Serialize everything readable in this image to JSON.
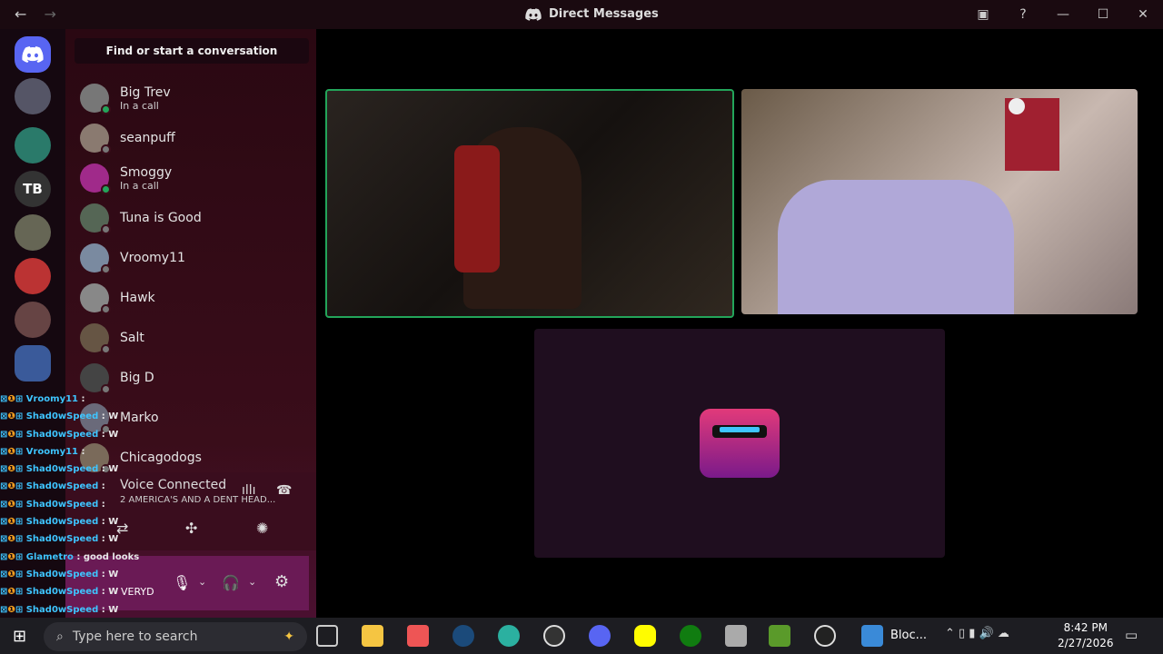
{
  "titlebar": {
    "title": "Direct Messages"
  },
  "guilds": [
    {
      "label": "",
      "color": "#5865f2"
    },
    {
      "label": "",
      "color": "#556"
    },
    {
      "label": "",
      "color": "#2a7a6a"
    },
    {
      "label": "TB",
      "color": "#333"
    },
    {
      "label": "",
      "color": "#665"
    },
    {
      "label": "",
      "color": "#b33"
    },
    {
      "label": "",
      "color": "#644"
    },
    {
      "label": "",
      "color": "#3a5a9a"
    }
  ],
  "dm_search": {
    "label": "Find or start a conversation"
  },
  "dms": [
    {
      "name": "Big Trev",
      "sub": "In a call",
      "online": true,
      "color": "#777"
    },
    {
      "name": "seanpuff",
      "sub": "",
      "online": false,
      "color": "#8a7a70"
    },
    {
      "name": "Smoggy",
      "sub": "In a call",
      "online": true,
      "color": "#a02a8a"
    },
    {
      "name": "Tuna is Good",
      "sub": "",
      "online": false,
      "color": "#556655"
    },
    {
      "name": "Vroomy11",
      "sub": "",
      "online": false,
      "color": "#7a8aa0"
    },
    {
      "name": "Hawk",
      "sub": "",
      "online": false,
      "color": "#888"
    },
    {
      "name": "Salt",
      "sub": "",
      "online": false,
      "color": "#665544"
    },
    {
      "name": "Big D",
      "sub": "",
      "online": false,
      "color": "#444"
    },
    {
      "name": "Marko",
      "sub": "",
      "online": false,
      "color": "#6a6a7a"
    },
    {
      "name": "Chicagodogs",
      "sub": "",
      "online": false,
      "color": "#7a6a5a"
    }
  ],
  "voice": {
    "status": "Voice Connected",
    "channel": "2 AMERICA'S AND A DENT HEAD..."
  },
  "user": {
    "name": "VERYD"
  },
  "chat": [
    {
      "user": "Vroomy11",
      "msg": ""
    },
    {
      "user": "Shad0wSpeed",
      "msg": "W"
    },
    {
      "user": "Shad0wSpeed",
      "msg": "W"
    },
    {
      "user": "Vroomy11",
      "msg": ""
    },
    {
      "user": "Shad0wSpeed",
      "msg": "W"
    },
    {
      "user": "Shad0wSpeed",
      "msg": ""
    },
    {
      "user": "Shad0wSpeed",
      "msg": ""
    },
    {
      "user": "Shad0wSpeed",
      "msg": "W"
    },
    {
      "user": "Shad0wSpeed",
      "msg": "W"
    },
    {
      "user": "Glametro",
      "msg": "good looks"
    },
    {
      "user": "Shad0wSpeed",
      "msg": "W"
    },
    {
      "user": "Shad0wSpeed",
      "msg": "W"
    },
    {
      "user": "Shad0wSpeed",
      "msg": "W"
    },
    {
      "user": "Shad0wSpeed",
      "msg": "W"
    }
  ],
  "taskbar": {
    "search_placeholder": "Type here to search",
    "active_app": "Bloc...",
    "time": "8:42 PM",
    "date": "2/27/2026"
  },
  "colors": {
    "accent": "#23a55a",
    "brand": "#5865f2"
  }
}
